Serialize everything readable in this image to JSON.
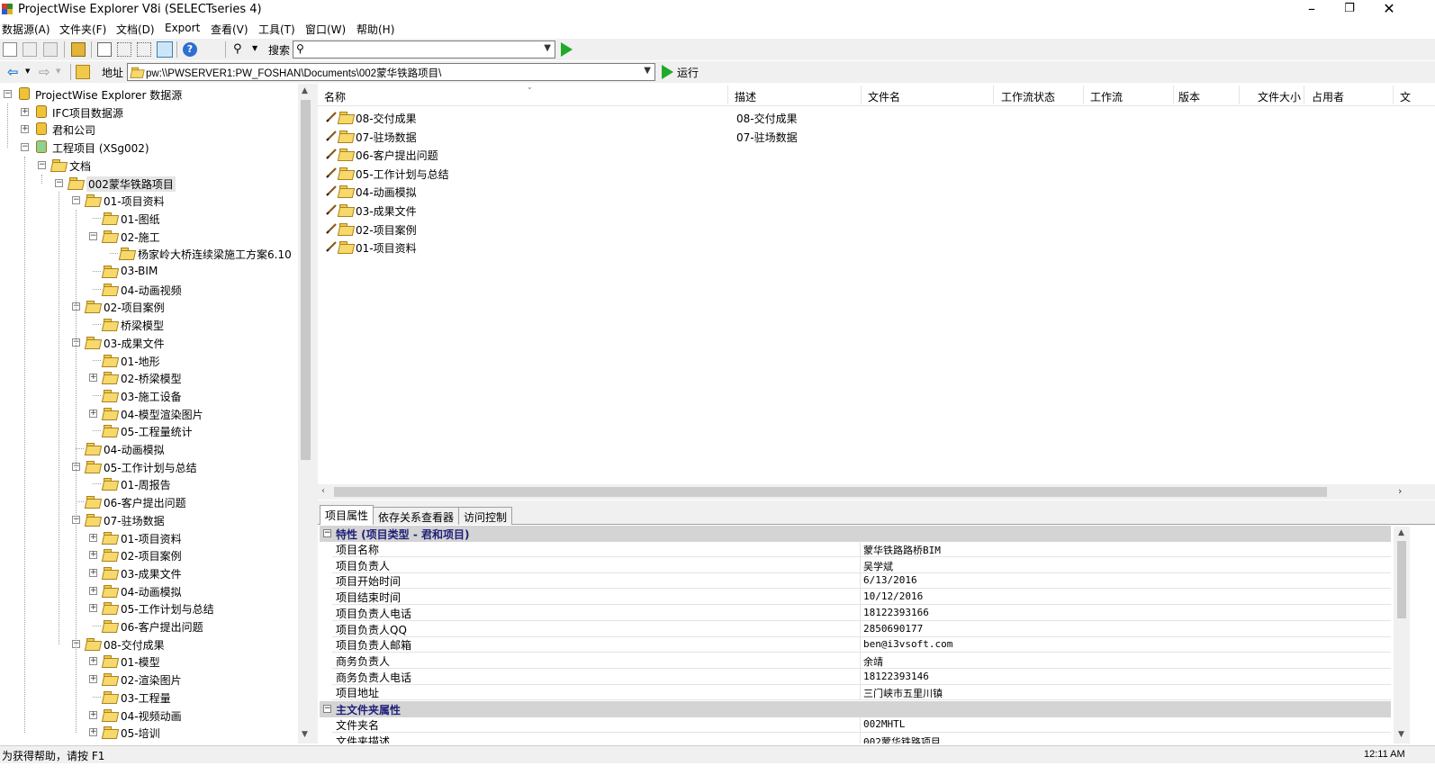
{
  "window": {
    "title": "ProjectWise Explorer V8i (SELECTseries 4)",
    "minimize": "–",
    "restore": "❐",
    "close": "✕"
  },
  "menu": [
    "数据源(A)",
    "文件夹(F)",
    "文档(D)",
    "Export",
    "查看(V)",
    "工具(T)",
    "窗口(W)",
    "帮助(H)"
  ],
  "toolbar": {
    "search_label": "搜索",
    "search_value": ""
  },
  "address": {
    "label": "地址",
    "value": "pw:\\\\PWSERVER1:PW_FOSHAN\\Documents\\002蒙华铁路项目\\",
    "run_label": "运行"
  },
  "tree": [
    {
      "label": "ProjectWise Explorer 数据源",
      "icon": "database-root-icon"
    },
    {
      "label": "IFC项目数据源",
      "icon": "datasource-icon"
    },
    {
      "label": "君和公司",
      "icon": "datasource-icon"
    },
    {
      "label": "工程项目 (XSg002)",
      "icon": "datasource-connected-icon"
    },
    {
      "label": "文档",
      "icon": "folder-icon"
    },
    {
      "label": "002蒙华铁路项目",
      "icon": "project-folder-icon"
    },
    {
      "label": "01-项目资料",
      "icon": "folder-icon"
    },
    {
      "label": "01-图纸",
      "icon": "folder-icon"
    },
    {
      "label": "02-施工",
      "icon": "folder-icon"
    },
    {
      "label": "杨家岭大桥连续梁施工方案6.10",
      "icon": "folder-icon"
    },
    {
      "label": "03-BIM",
      "icon": "folder-icon"
    },
    {
      "label": "04-动画视频",
      "icon": "folder-icon"
    },
    {
      "label": "02-项目案例",
      "icon": "folder-icon"
    },
    {
      "label": "桥梁模型",
      "icon": "folder-icon"
    },
    {
      "label": "03-成果文件",
      "icon": "folder-icon"
    },
    {
      "label": "01-地形",
      "icon": "folder-icon"
    },
    {
      "label": "02-桥梁模型",
      "icon": "folder-icon"
    },
    {
      "label": "03-施工设备",
      "icon": "folder-icon"
    },
    {
      "label": "04-模型渲染图片",
      "icon": "folder-icon"
    },
    {
      "label": "05-工程量统计",
      "icon": "folder-icon"
    },
    {
      "label": "04-动画模拟",
      "icon": "folder-icon"
    },
    {
      "label": "05-工作计划与总结",
      "icon": "folder-icon"
    },
    {
      "label": "01-周报告",
      "icon": "folder-icon"
    },
    {
      "label": "06-客户提出问题",
      "icon": "folder-icon"
    },
    {
      "label": "07-驻场数据",
      "icon": "folder-icon"
    },
    {
      "label": "01-项目资料",
      "icon": "folder-icon"
    },
    {
      "label": "02-项目案例",
      "icon": "folder-icon"
    },
    {
      "label": "03-成果文件",
      "icon": "folder-icon"
    },
    {
      "label": "04-动画模拟",
      "icon": "folder-icon"
    },
    {
      "label": "05-工作计划与总结",
      "icon": "folder-icon"
    },
    {
      "label": "06-客户提出问题",
      "icon": "folder-icon"
    },
    {
      "label": "08-交付成果",
      "icon": "folder-icon"
    },
    {
      "label": "01-模型",
      "icon": "folder-icon"
    },
    {
      "label": "02-渲染图片",
      "icon": "folder-icon"
    },
    {
      "label": "03-工程量",
      "icon": "folder-icon"
    },
    {
      "label": "04-视频动画",
      "icon": "folder-icon"
    },
    {
      "label": "05-培训",
      "icon": "folder-icon"
    }
  ],
  "list": {
    "columns": [
      "名称",
      "描述",
      "文件名",
      "工作流状态",
      "工作流",
      "版本",
      "文件大小",
      "占用者",
      "文"
    ],
    "rows": [
      {
        "name": "08-交付成果",
        "desc": "08-交付成果"
      },
      {
        "name": "07-驻场数据",
        "desc": "07-驻场数据"
      },
      {
        "name": "06-客户提出问题",
        "desc": ""
      },
      {
        "name": "05-工作计划与总结",
        "desc": ""
      },
      {
        "name": "04-动画模拟",
        "desc": ""
      },
      {
        "name": "03-成果文件",
        "desc": ""
      },
      {
        "name": "02-项目案例",
        "desc": ""
      },
      {
        "name": "01-项目资料",
        "desc": ""
      }
    ]
  },
  "tabs": [
    "项目属性",
    "依存关系查看器",
    "访问控制"
  ],
  "properties": {
    "group1": "特性 (项目类型 - 君和项目)",
    "rows1": [
      {
        "k": "项目名称",
        "v": "蒙华铁路路桥BIM"
      },
      {
        "k": "项目负责人",
        "v": "吴学斌"
      },
      {
        "k": "项目开始时间",
        "v": "6/13/2016"
      },
      {
        "k": "项目结束时间",
        "v": "10/12/2016"
      },
      {
        "k": "项目负责人电话",
        "v": "18122393166"
      },
      {
        "k": "项目负责人QQ",
        "v": "2850690177"
      },
      {
        "k": "项目负责人邮箱",
        "v": "ben@i3vsoft.com"
      },
      {
        "k": "商务负责人",
        "v": "余靖"
      },
      {
        "k": "商务负责人电话",
        "v": "18122393146"
      },
      {
        "k": "项目地址",
        "v": "三门峡市五里川镇"
      }
    ],
    "group2": "主文件夹属性",
    "rows2": [
      {
        "k": "文件夹名",
        "v": "002MHTL"
      },
      {
        "k": "文件夹描述",
        "v": "002蒙华铁路项目"
      }
    ]
  },
  "status": {
    "text": "为获得帮助，请按 F1",
    "clock": "12:11 AM"
  }
}
